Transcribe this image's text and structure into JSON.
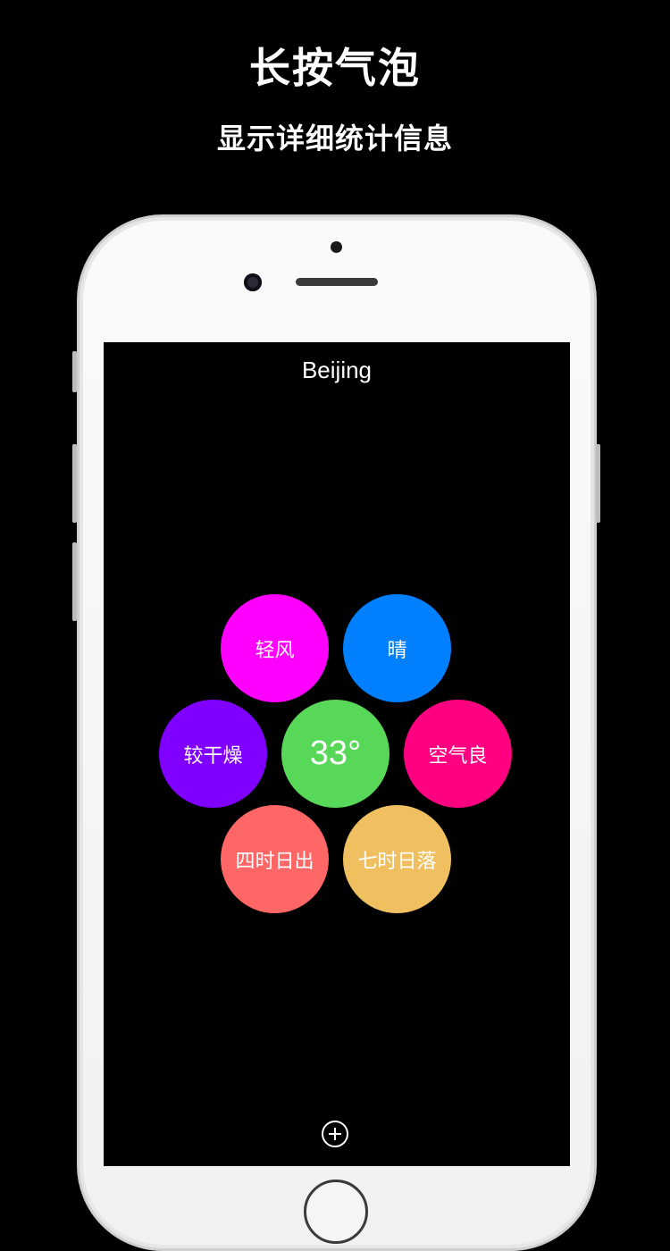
{
  "promo": {
    "title": "长按气泡",
    "subtitle": "显示详细统计信息"
  },
  "app": {
    "city": "Beijing",
    "bubbles": [
      {
        "label": "轻风",
        "color": "#ff00ff"
      },
      {
        "label": "晴",
        "color": "#0080ff"
      },
      {
        "label": "较干燥",
        "color": "#8000ff"
      },
      {
        "label": "33°",
        "color": "#58d858"
      },
      {
        "label": "空气良",
        "color": "#ff0080"
      },
      {
        "label": "四时日出",
        "color": "#ff6666"
      },
      {
        "label": "七时日落",
        "color": "#f0c060"
      }
    ],
    "add_icon": "plus-circle-icon"
  }
}
